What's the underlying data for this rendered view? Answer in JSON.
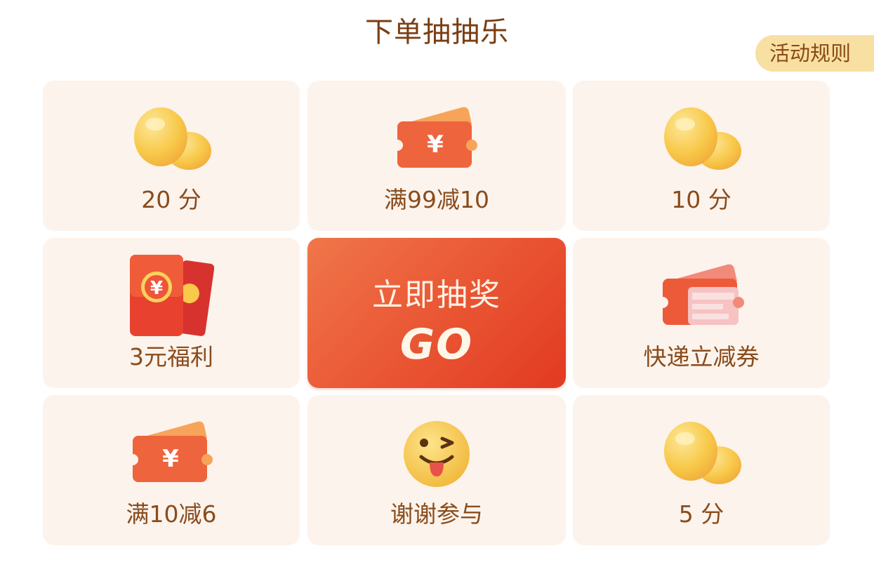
{
  "header": {
    "title": "下单抽抽乐",
    "rules_label": "活动规则"
  },
  "prizes": [
    {
      "label": "20 分",
      "icon": "beans-icon"
    },
    {
      "label": "满99减10",
      "icon": "coupon-icon"
    },
    {
      "label": "10  分",
      "icon": "beans-icon"
    },
    {
      "label": "3元福利",
      "icon": "red-envelope-icon"
    },
    {
      "label": "快递立减券",
      "icon": "express-coupon-icon"
    },
    {
      "label": "满10减6",
      "icon": "coupon-icon"
    },
    {
      "label": "谢谢参与",
      "icon": "tongue-emoji-icon"
    },
    {
      "label": "5  分",
      "icon": "beans-icon"
    }
  ],
  "draw_button": {
    "title": "立即抽奖",
    "go": "GO"
  },
  "colors": {
    "title": "#7a3d12",
    "cell_bg": "#fcf3ec",
    "label": "#8a4c1c",
    "rules_bg": "#f8dfa2",
    "accent": "#e23a22"
  }
}
